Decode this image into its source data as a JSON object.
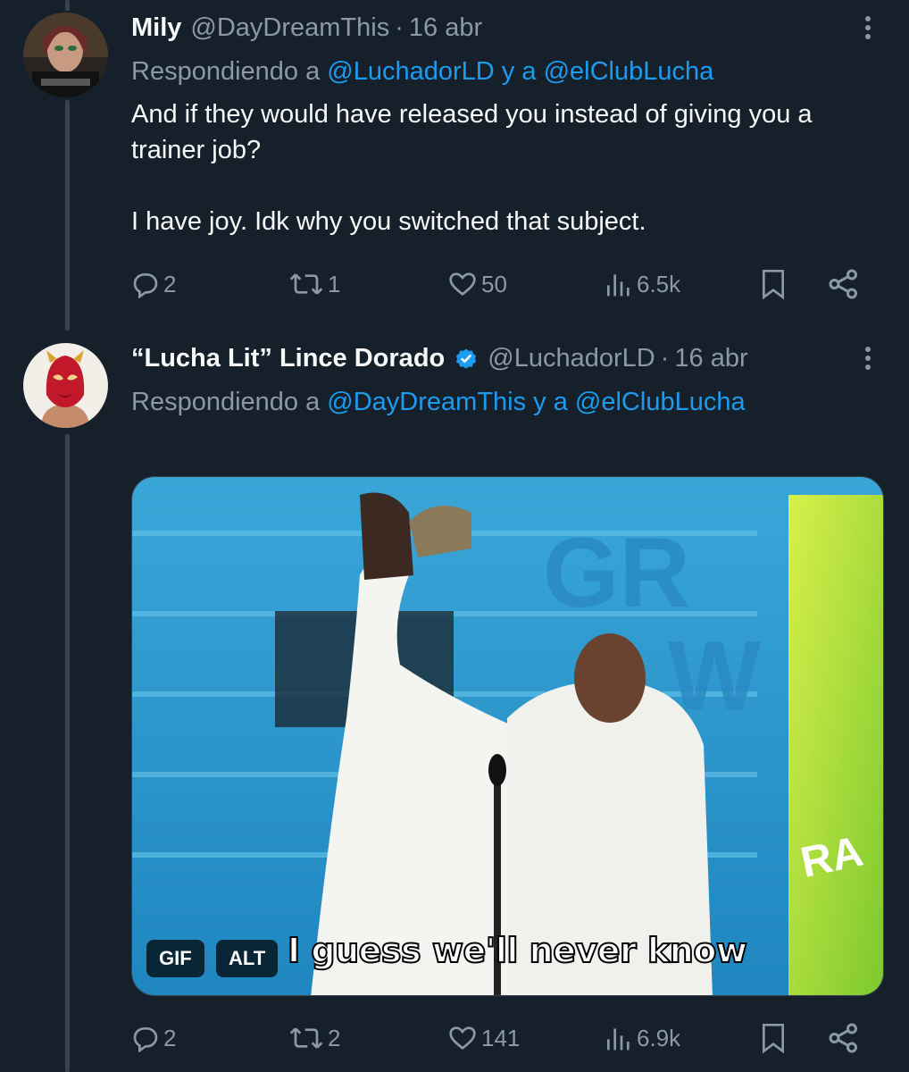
{
  "tweets": [
    {
      "name": "Mily",
      "handle": "@DayDreamThis",
      "separator": "·",
      "time": "16 abr",
      "reply_prefix": "Respondiendo a",
      "reply_mention_1": "@LuchadorLD",
      "reply_joiner": "y a",
      "reply_mention_2": "@elClubLucha",
      "text_lines": [
        "And if they would have released you instead of giving you a",
        "trainer job?",
        "I have joy. Idk why you switched that subject."
      ],
      "replies": "2",
      "retweets": "1",
      "likes": "50",
      "views": "6.5k"
    },
    {
      "name": "“Lucha Lit” Lince Dorado",
      "verified": true,
      "handle": "@LuchadorLD",
      "separator": "·",
      "time": "16 abr",
      "reply_prefix": "Respondiendo a",
      "reply_mention_1": "@DayDreamThis",
      "reply_joiner": "y a",
      "reply_mention_2": "@elClubLucha",
      "media": {
        "gif_badge": "GIF",
        "alt_badge": "ALT",
        "caption": "I guess we'll never know"
      },
      "replies": "2",
      "retweets": "2",
      "likes": "141",
      "views": "6.9k"
    }
  ],
  "colors": {
    "background": "#15202b",
    "text": "#f7f9f9",
    "muted": "#8b98a5",
    "link": "#1d9bf0",
    "thread_line": "#38444d"
  },
  "icons": [
    "reply-icon",
    "retweet-icon",
    "like-icon",
    "views-icon",
    "bookmark-icon",
    "share-icon",
    "more-icon",
    "verified-icon"
  ]
}
